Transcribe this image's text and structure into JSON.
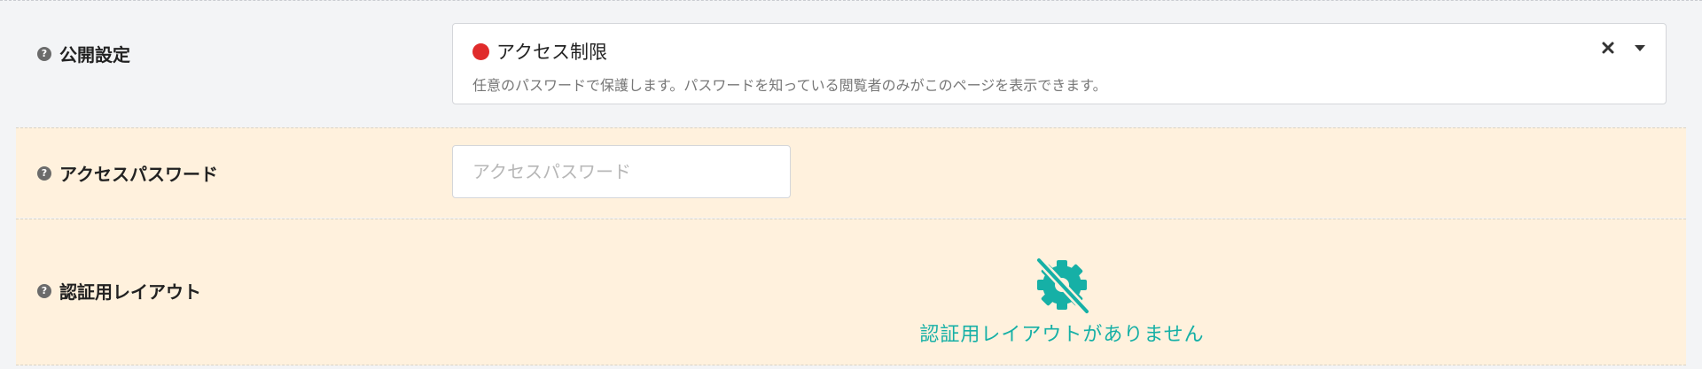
{
  "visibility": {
    "label": "公開設定",
    "help_icon": "?",
    "selected_title": "アクセス制限",
    "selected_description": "任意のパスワードで保護します。パスワードを知っている閲覧者のみがこのページを表示できます。",
    "status_color": "#e02b2b",
    "clear_icon": "close-icon",
    "dropdown_icon": "chevron-down-icon"
  },
  "password": {
    "label": "アクセスパスワード",
    "help_icon": "?",
    "value": "",
    "placeholder": "アクセスパスワード"
  },
  "auth_layout": {
    "label": "認証用レイアウト",
    "help_icon": "?",
    "empty_icon": "gear-off-icon",
    "empty_message": "認証用レイアウトがありません",
    "accent_color": "#16b0a6"
  },
  "colors": {
    "highlight_row_bg": "#fff1dd",
    "page_bg": "#f3f4f6"
  }
}
